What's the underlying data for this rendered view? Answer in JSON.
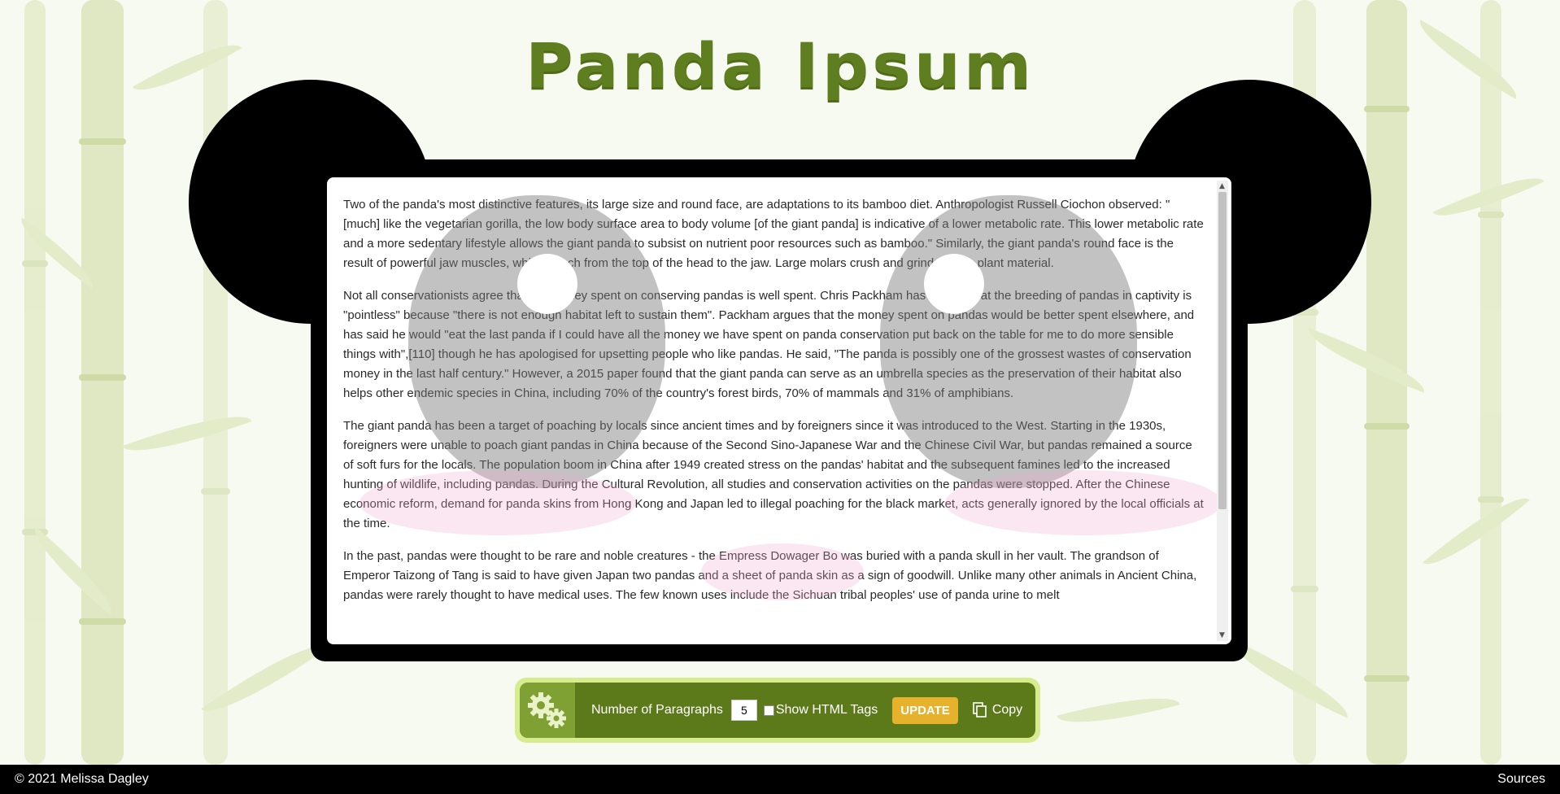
{
  "header": {
    "title": "Panda Ipsum"
  },
  "paragraphs": [
    "Two of the panda's most distinctive features, its large size and round face, are adaptations to its bamboo diet. Anthropologist Russell Ciochon observed: \"[much] like the vegetarian gorilla, the low body surface area to body volume [of the giant panda] is indicative of a lower metabolic rate. This lower metabolic rate and a more sedentary lifestyle allows the giant panda to subsist on nutrient poor resources such as bamboo.\" Similarly, the giant panda's round face is the result of powerful jaw muscles, which attach from the top of the head to the jaw. Large molars crush and grind fibrous plant material.",
    "Not all conservationists agree that the money spent on conserving pandas is well spent. Chris Packham has argued that the breeding of pandas in captivity is \"pointless\" because \"there is not enough habitat left to sustain them\". Packham argues that the money spent on pandas would be better spent elsewhere, and has said he would \"eat the last panda if I could have all the money we have spent on panda conservation put back on the table for me to do more sensible things with\",[110] though he has apologised for upsetting people who like pandas. He said, \"The panda is possibly one of the grossest wastes of conservation money in the last half century.\" However, a 2015 paper found that the giant panda can serve as an umbrella species as the preservation of their habitat also helps other endemic species in China, including 70% of the country's forest birds, 70% of mammals and 31% of amphibians.",
    "The giant panda has been a target of poaching by locals since ancient times and by foreigners since it was introduced to the West. Starting in the 1930s, foreigners were unable to poach giant pandas in China because of the Second Sino-Japanese War and the Chinese Civil War, but pandas remained a source of soft furs for the locals. The population boom in China after 1949 created stress on the pandas' habitat and the subsequent famines led to the increased hunting of wildlife, including pandas. During the Cultural Revolution, all studies and conservation activities on the pandas were stopped. After the Chinese economic reform, demand for panda skins from Hong Kong and Japan led to illegal poaching for the black market, acts generally ignored by the local officials at the time.",
    "In the past, pandas were thought to be rare and noble creatures - the Empress Dowager Bo was buried with a panda skull in her vault. The grandson of Emperor Taizong of Tang is said to have given Japan two pandas and a sheet of panda skin as a sign of goodwill. Unlike many other animals in Ancient China, pandas were rarely thought to have medical uses. The few known uses include the Sichuan tribal peoples' use of panda urine to melt"
  ],
  "controls": {
    "paragraphs_label": "Number of Paragraphs",
    "paragraphs_value": "5",
    "show_html_label": "Show HTML Tags",
    "update_label": "UPDATE",
    "copy_label": "Copy"
  },
  "footer": {
    "copyright": "© 2021 Melissa Dagley",
    "sources": "Sources"
  },
  "colors": {
    "accent_green": "#5d7a1a",
    "light_green": "#d7eb8f",
    "update_yellow": "#e6b22c"
  }
}
